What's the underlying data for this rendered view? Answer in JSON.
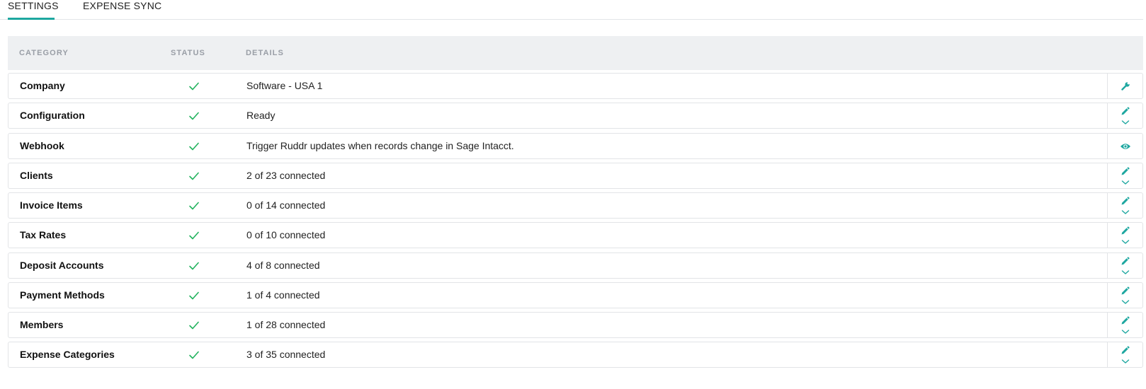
{
  "tabs": [
    {
      "label": "SETTINGS",
      "active": true
    },
    {
      "label": "EXPENSE SYNC",
      "active": false
    }
  ],
  "table": {
    "headers": {
      "category": "CATEGORY",
      "status": "STATUS",
      "details": "DETAILS"
    },
    "rows": [
      {
        "category": "Company",
        "status": "check-icon",
        "details": "Software - USA 1",
        "actions": [
          "wrench-icon"
        ]
      },
      {
        "category": "Configuration",
        "status": "check-icon",
        "details": "Ready",
        "actions": [
          "pencil-icon",
          "chevron-down-icon"
        ]
      },
      {
        "category": "Webhook",
        "status": "check-icon",
        "details": "Trigger Ruddr updates when records change in Sage Intacct.",
        "actions": [
          "eye-icon"
        ]
      },
      {
        "category": "Clients",
        "status": "check-icon",
        "details": "2 of 23 connected",
        "actions": [
          "pencil-icon",
          "chevron-down-icon"
        ]
      },
      {
        "category": "Invoice Items",
        "status": "check-icon",
        "details": "0 of 14 connected",
        "actions": [
          "pencil-icon",
          "chevron-down-icon"
        ]
      },
      {
        "category": "Tax Rates",
        "status": "check-icon",
        "details": "0 of 10 connected",
        "actions": [
          "pencil-icon",
          "chevron-down-icon"
        ]
      },
      {
        "category": "Deposit Accounts",
        "status": "check-icon",
        "details": "4 of 8 connected",
        "actions": [
          "pencil-icon",
          "chevron-down-icon"
        ]
      },
      {
        "category": "Payment Methods",
        "status": "check-icon",
        "details": "1 of 4 connected",
        "actions": [
          "pencil-icon",
          "chevron-down-icon"
        ]
      },
      {
        "category": "Members",
        "status": "check-icon",
        "details": "1 of 28 connected",
        "actions": [
          "pencil-icon",
          "chevron-down-icon"
        ]
      },
      {
        "category": "Expense Categories",
        "status": "check-icon",
        "details": "3 of 35 connected",
        "actions": [
          "pencil-icon",
          "chevron-down-icon"
        ]
      }
    ]
  },
  "colors": {
    "accent": "#1ea7a0",
    "check": "#22b35e",
    "header_bg": "#eef0f2",
    "header_text": "#999ea6"
  }
}
